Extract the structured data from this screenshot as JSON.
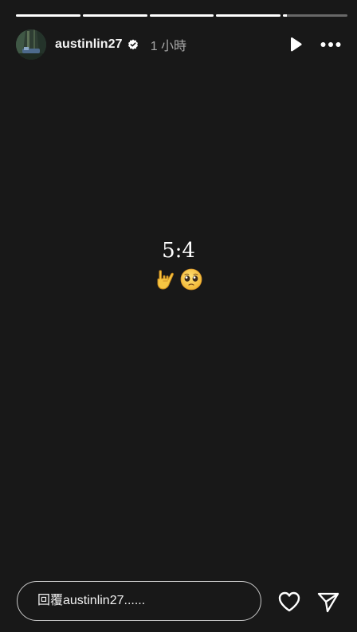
{
  "story": {
    "progress": [
      1,
      1,
      1,
      1,
      0.06,
      0
    ],
    "user": {
      "username": "austinlin27",
      "verified": true,
      "time": "1 小時"
    },
    "content": {
      "text": "5:4",
      "emojis": [
        "rock-on-hand-emoji",
        "pleading-face-emoji"
      ]
    },
    "reply": {
      "placeholder": "回覆austinlin27......"
    },
    "icons": {
      "play": "play-icon",
      "more": "more-icon",
      "like": "heart-icon",
      "share": "send-icon"
    },
    "colors": {
      "background": "#181818",
      "text": "#ffffff",
      "muted": "#a8a8a8"
    }
  }
}
